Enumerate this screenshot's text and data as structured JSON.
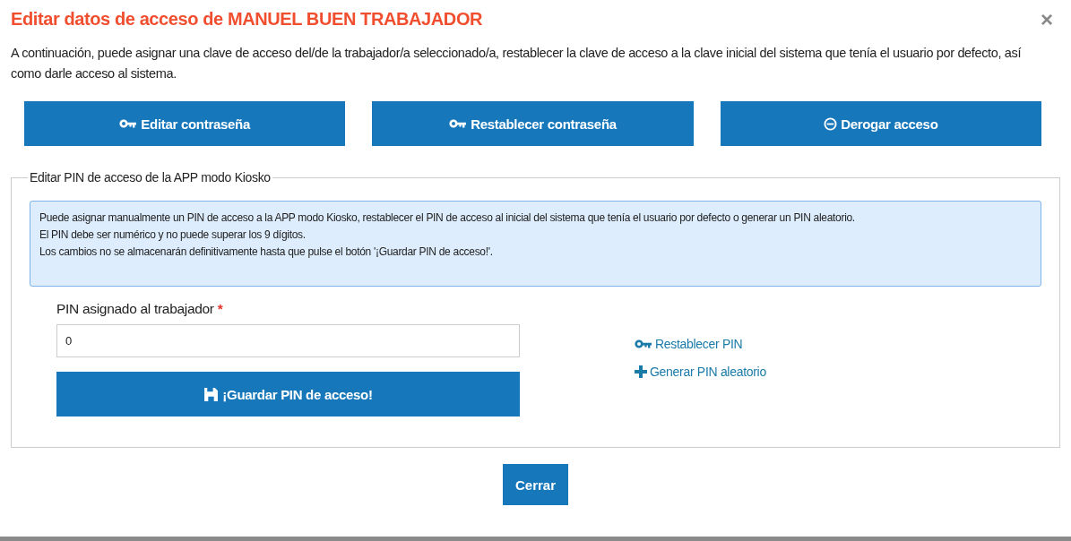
{
  "dialog": {
    "title": "Editar datos de acceso de MANUEL BUEN TRABAJADOR",
    "close": "×",
    "intro": "A continuación, puede asignar una clave de acceso del/de la trabajador/a seleccionado/a, restablecer la clave de acceso a la clave inicial del sistema que tenía el usuario por defecto, así como darle acceso al sistema.",
    "actions": [
      {
        "label": "Editar contraseña",
        "kind": "key"
      },
      {
        "label": "Restablecer contraseña",
        "kind": "key"
      },
      {
        "label": "Derogar acceso",
        "kind": "revoke"
      }
    ],
    "kiosk": {
      "legend": "Editar PIN de acceso de la APP modo Kiosko",
      "info": [
        "Puede asignar manualmente un PIN de acceso a la APP modo Kiosko, restablecer el PIN de acceso al inicial del sistema que tenía el usuario por defecto o generar un PIN aleatorio.",
        "El PIN debe ser numérico y no puede superar los 9 dígitos.",
        "Los cambios no se almacenarán definitivamente hasta que pulse el botón '¡Guardar PIN de acceso!'."
      ],
      "pin_label": "PIN asignado al trabajador",
      "required_mark": "*",
      "pin_value": "0",
      "save": {
        "label": "¡Guardar PIN de acceso!",
        "kind": "save"
      },
      "links": [
        {
          "label": "Restablecer PIN",
          "kind": "key"
        },
        {
          "label": "Generar PIN aleatorio",
          "kind": "add"
        }
      ]
    },
    "footer_button": "Cerrar"
  }
}
